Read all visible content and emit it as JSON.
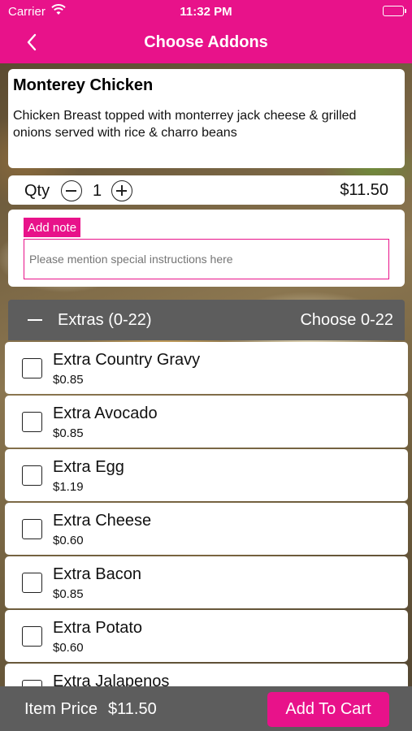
{
  "status_bar": {
    "carrier": "Carrier",
    "time": "11:32 PM"
  },
  "nav": {
    "title": "Choose Addons"
  },
  "item": {
    "name": "Monterey Chicken",
    "description": "Chicken Breast topped with monterrey jack cheese & grilled onions served with rice & charro beans",
    "qty_label": "Qty",
    "qty": "1",
    "price": "$11.50"
  },
  "note": {
    "label": "Add note",
    "placeholder": "Please mention special instructions here"
  },
  "extras": {
    "title": "Extras (0-22)",
    "choose": "Choose 0-22",
    "items": [
      {
        "name": "Extra Country Gravy",
        "price": "$0.85"
      },
      {
        "name": "Extra Avocado",
        "price": "$0.85"
      },
      {
        "name": "Extra Egg",
        "price": "$1.19"
      },
      {
        "name": "Extra Cheese",
        "price": "$0.60"
      },
      {
        "name": "Extra Bacon",
        "price": "$0.85"
      },
      {
        "name": "Extra Potato",
        "price": "$0.60"
      },
      {
        "name": "Extra Jalapenos",
        "price": ""
      }
    ]
  },
  "footer": {
    "item_price_label": "Item Price",
    "item_price": "$11.50",
    "add_to_cart": "Add To Cart"
  },
  "colors": {
    "brand": "#e8128a",
    "header_gray": "#5d5d5d"
  },
  "icons": [
    "wifi-icon",
    "battery-icon",
    "back-chevron-icon",
    "minus-circle-icon",
    "plus-circle-icon",
    "collapse-icon",
    "checkbox-icon"
  ]
}
